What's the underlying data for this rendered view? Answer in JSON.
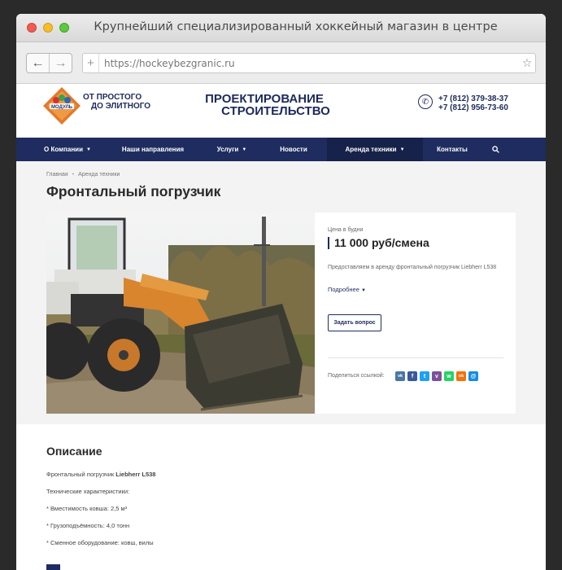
{
  "browser": {
    "title": "Крупнейший специализированный хоккейный магазин в центре",
    "url": "https://hockeybezgranic.ru",
    "back_icon": "arrow-left-icon",
    "forward_icon": "arrow-right-icon"
  },
  "site": {
    "logo_name": "МОДУЛЬ",
    "logo_line1": "ОТ ПРОСТОГО",
    "logo_line2": "ДО ЭЛИТНОГО",
    "slogan_line1": "ПРОЕКТИРОВАНИЕ",
    "slogan_line2": "СТРОИТЕЛЬСТВО",
    "phone1": "+7 (812) 379-38-37",
    "phone2": "+7 (812) 956-73-60",
    "brand_color": "#1f2c5f"
  },
  "nav": {
    "items": [
      {
        "label": "О Компании",
        "has_caret": true
      },
      {
        "label": "Наши направления",
        "has_caret": false
      },
      {
        "label": "Услуги",
        "has_caret": true
      },
      {
        "label": "Новости",
        "has_caret": false
      },
      {
        "label": "Аренда техники",
        "has_caret": true,
        "active": true
      },
      {
        "label": "Контакты",
        "has_caret": false
      }
    ],
    "search_icon": "search-icon"
  },
  "breadcrumb": {
    "home": "Главная",
    "current": "Аренда техники"
  },
  "page": {
    "title": "Фронтальный погрузчик"
  },
  "product": {
    "price_caption": "Цена в будни",
    "price": "11 000 руб/смена",
    "short_description": "Предоставляем в аренду фронтальный погрузчик Liebherr L538",
    "more_link": "Подробнее",
    "ask_button": "Задать вопрос",
    "share_label": "Поделиться ссылкой:",
    "share_icons": [
      {
        "name": "vk-icon",
        "glyph": "vk",
        "color": "#4c75a3"
      },
      {
        "name": "facebook-icon",
        "glyph": "f",
        "color": "#3b5998"
      },
      {
        "name": "twitter-icon",
        "glyph": "t",
        "color": "#1da1f2"
      },
      {
        "name": "viber-icon",
        "glyph": "v",
        "color": "#7b519d"
      },
      {
        "name": "whatsapp-icon",
        "glyph": "w",
        "color": "#25d366"
      },
      {
        "name": "odnoklassniki-icon",
        "glyph": "ok",
        "color": "#f2720c"
      },
      {
        "name": "moimir-icon",
        "glyph": "@",
        "color": "#168de2"
      }
    ]
  },
  "description": {
    "title": "Описание",
    "line1_prefix": "Фронтальный погрузчик ",
    "line1_model": "Liebherr L538",
    "line2": "Технические характеристики:",
    "line3": "* Вместимость ковша: 2,5 м³",
    "line4": "* Грузоподъёмность: 4,0 тонн",
    "line5": "* Сменное оборудование: ковш, вилы"
  }
}
